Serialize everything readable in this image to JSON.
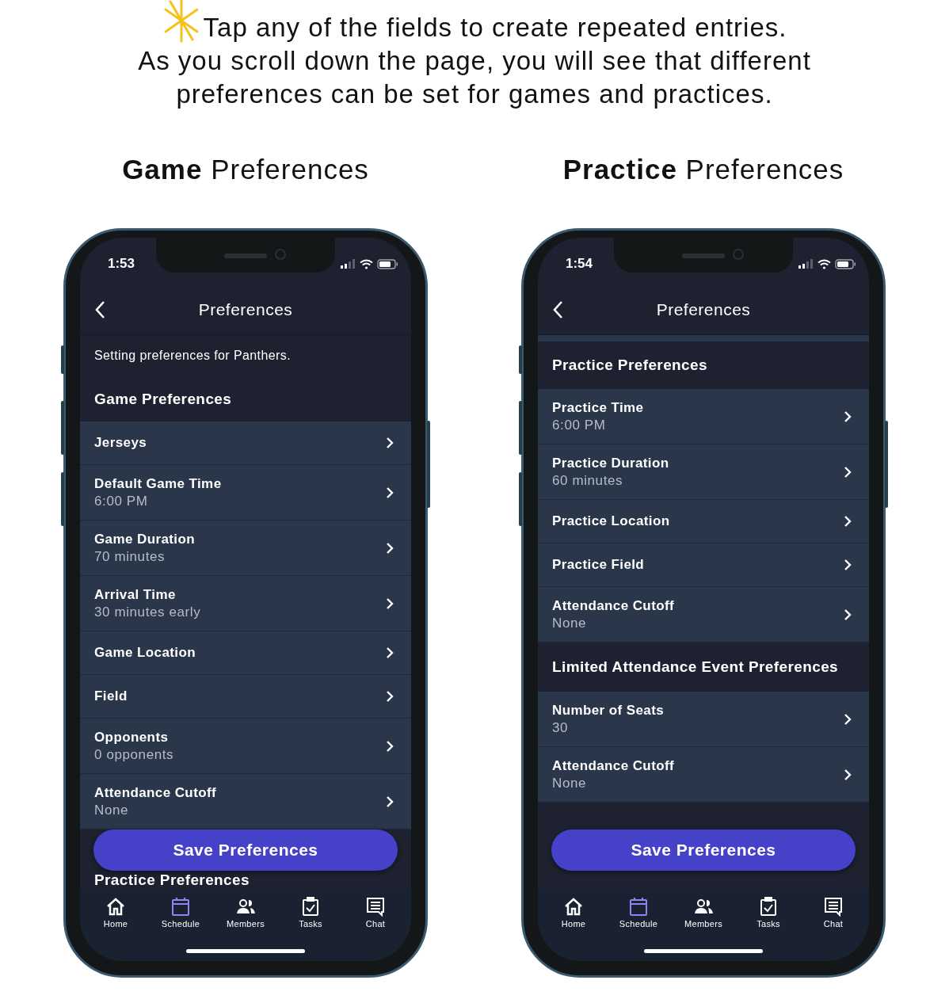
{
  "caption_lines": [
    "Tap any of the fields to create repeated entries.",
    "As you scroll down the page, you will see that different",
    "preferences can be set for games and practices."
  ],
  "phones": [
    {
      "heading": "**Game** Preferences",
      "time": "1:53",
      "title": "Preferences",
      "items": [
        {
          "kind": "note",
          "text": "Setting preferences for Panthers."
        },
        {
          "kind": "header",
          "text": "Game Preferences"
        },
        {
          "kind": "row",
          "label": "Jerseys"
        },
        {
          "kind": "row",
          "label": "Default Game Time",
          "value": "6:00 PM"
        },
        {
          "kind": "row",
          "label": "Game Duration",
          "value": "70 minutes"
        },
        {
          "kind": "row",
          "label": "Arrival Time",
          "value": "30 minutes early"
        },
        {
          "kind": "row",
          "label": "Game Location"
        },
        {
          "kind": "row",
          "label": "Field"
        },
        {
          "kind": "row",
          "label": "Opponents",
          "value": "0 opponents"
        },
        {
          "kind": "row",
          "label": "Attendance Cutoff",
          "value": "None"
        },
        {
          "kind": "header",
          "text": "Practice Preferences"
        }
      ],
      "button": "Save Preferences",
      "tabs": [
        {
          "kind": "home",
          "label": "Home",
          "selected": false
        },
        {
          "kind": "calendar",
          "label": "Schedule",
          "selected": true
        },
        {
          "kind": "people",
          "label": "Members",
          "selected": false
        },
        {
          "kind": "clipboard",
          "label": "Tasks",
          "selected": false
        },
        {
          "kind": "chat",
          "label": "Chat",
          "selected": false
        }
      ]
    },
    {
      "heading": "**Practice** Preferences",
      "time": "1:54",
      "title": "Preferences",
      "items": [
        {
          "kind": "header",
          "text": "Practice Preferences"
        },
        {
          "kind": "row",
          "label": "Practice Time",
          "value": "6:00 PM"
        },
        {
          "kind": "row",
          "label": "Practice Duration",
          "value": "60 minutes"
        },
        {
          "kind": "row",
          "label": "Practice Location"
        },
        {
          "kind": "row",
          "label": "Practice Field"
        },
        {
          "kind": "row",
          "label": "Attendance Cutoff",
          "value": "None"
        },
        {
          "kind": "header",
          "text": "Limited Attendance Event Preferences"
        },
        {
          "kind": "row",
          "label": "Number of Seats",
          "value": "30"
        },
        {
          "kind": "row",
          "label": "Attendance Cutoff",
          "value": "None"
        }
      ],
      "button": "Save Preferences",
      "tabs": [
        {
          "kind": "home",
          "label": "Home",
          "selected": false
        },
        {
          "kind": "calendar",
          "label": "Schedule",
          "selected": true
        },
        {
          "kind": "people",
          "label": "Members",
          "selected": false
        },
        {
          "kind": "clipboard",
          "label": "Tasks",
          "selected": false
        },
        {
          "kind": "chat",
          "label": "Chat",
          "selected": false
        }
      ]
    }
  ]
}
